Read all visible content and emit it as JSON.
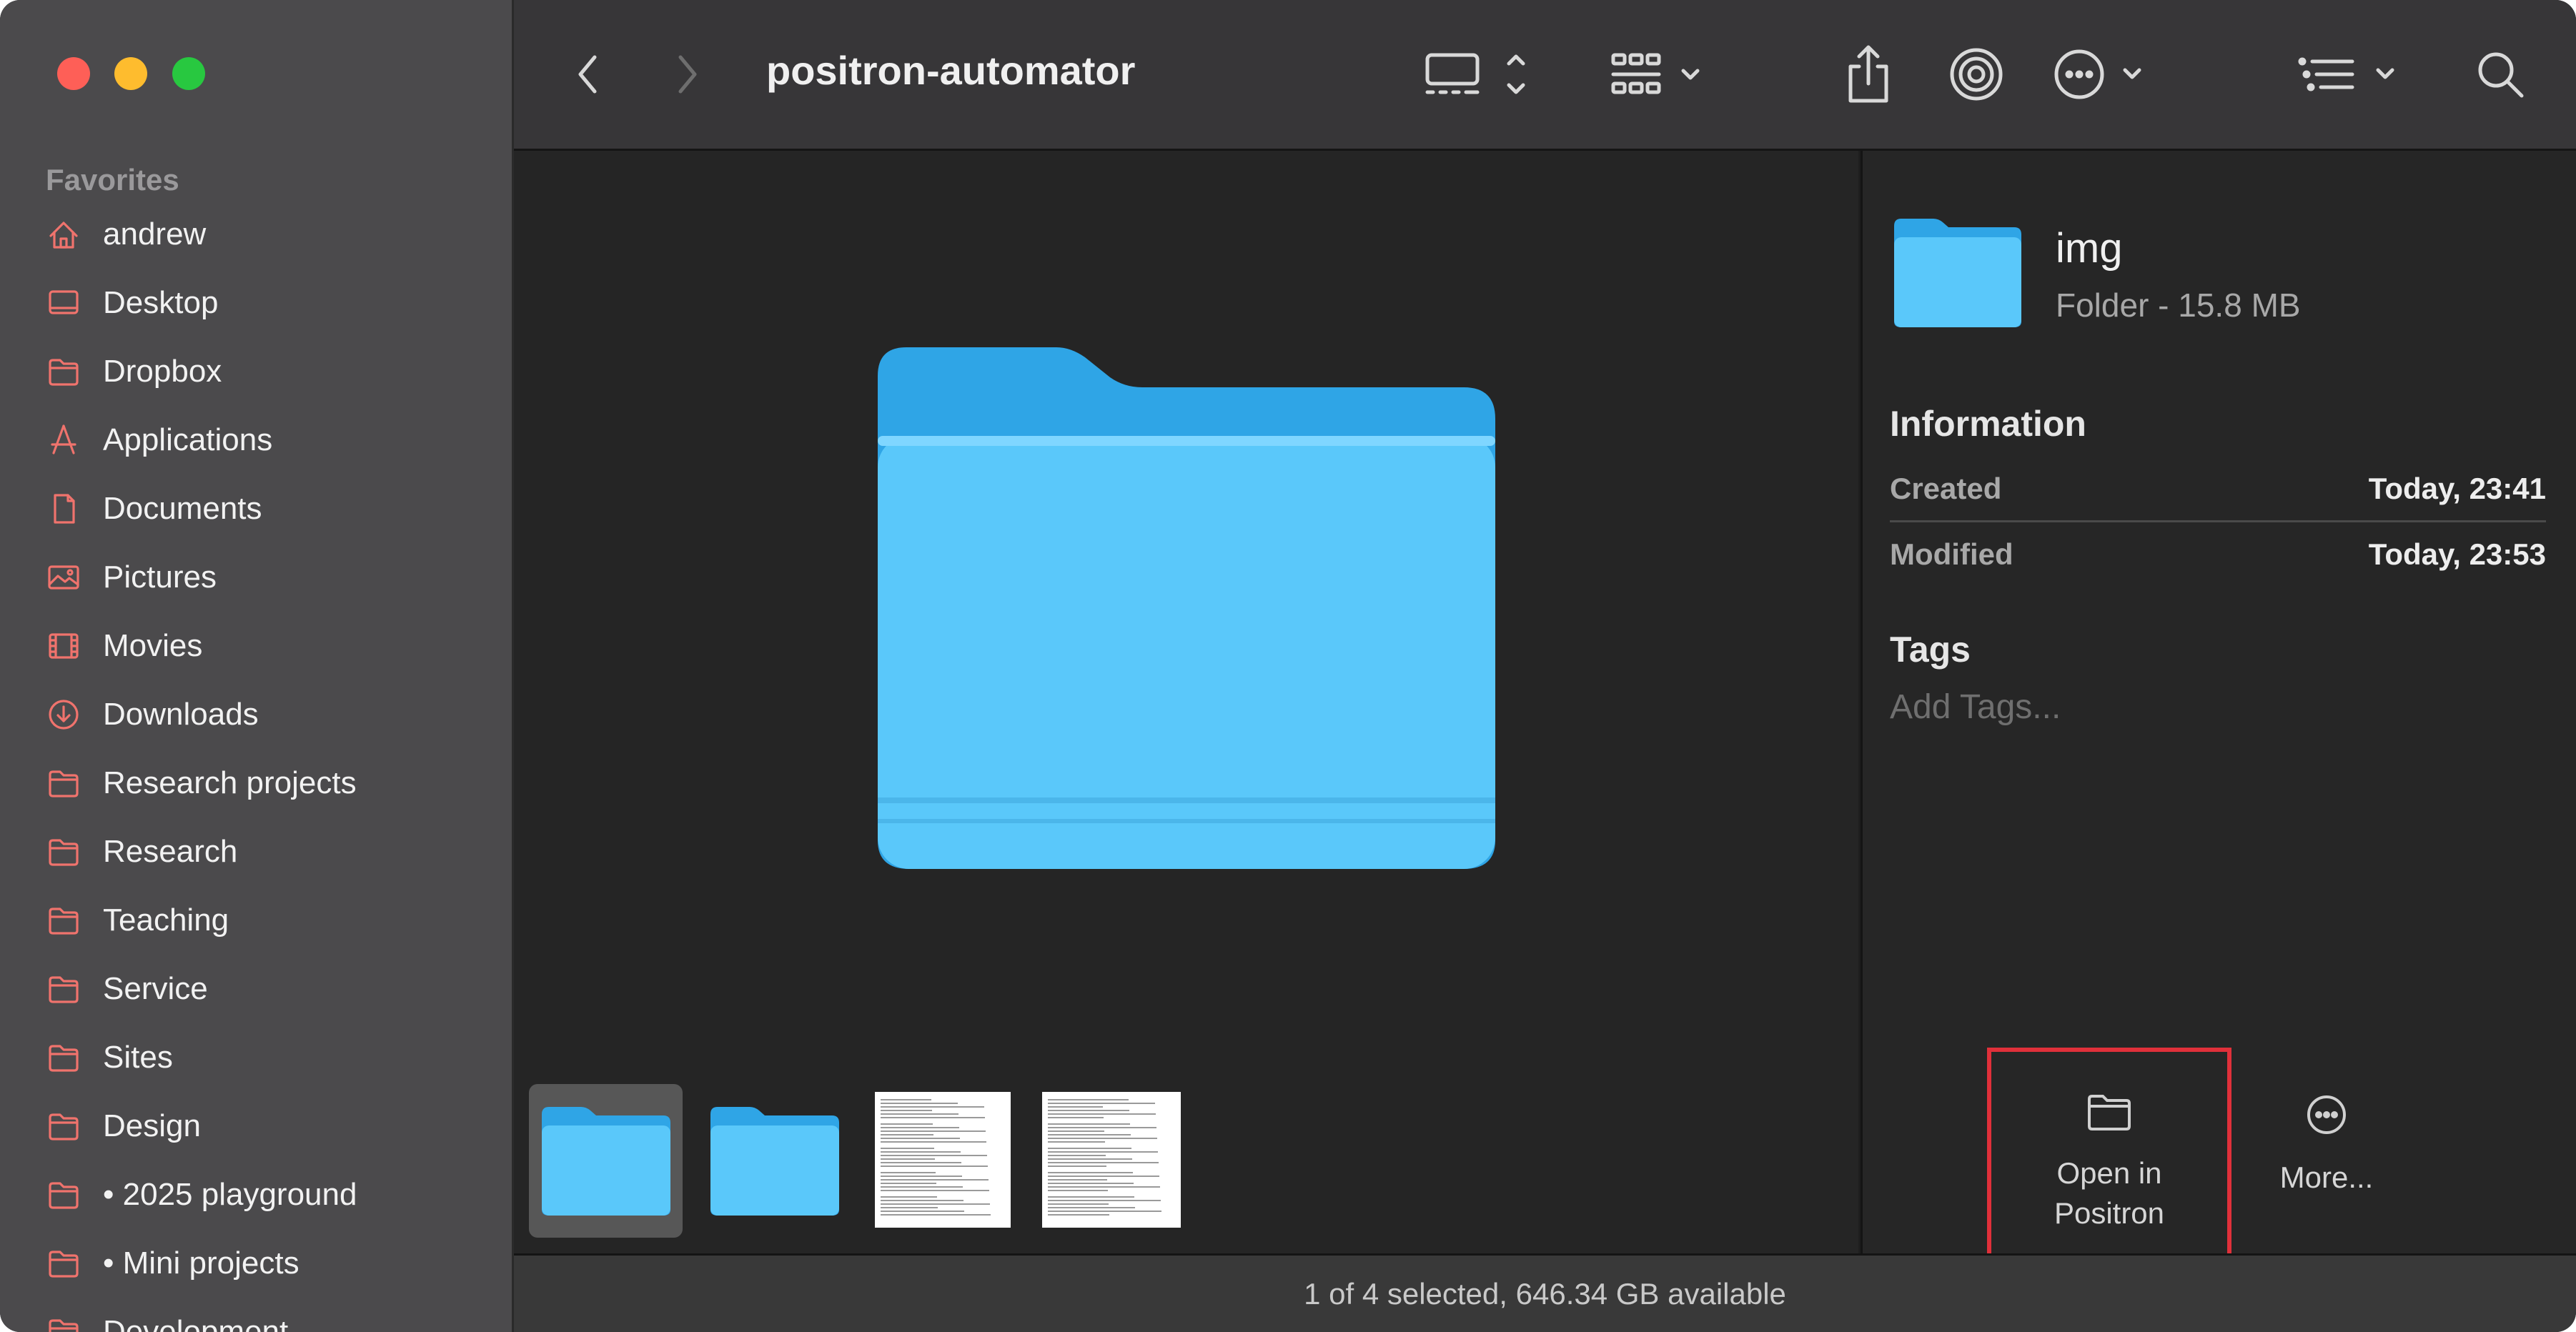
{
  "window": {
    "title": "positron-automator"
  },
  "sidebar": {
    "section": "Favorites",
    "items": [
      {
        "label": "andrew",
        "icon": "home-icon"
      },
      {
        "label": "Desktop",
        "icon": "desktop-icon"
      },
      {
        "label": "Dropbox",
        "icon": "folder-icon"
      },
      {
        "label": "Applications",
        "icon": "applications-icon"
      },
      {
        "label": "Documents",
        "icon": "document-icon"
      },
      {
        "label": "Pictures",
        "icon": "pictures-icon"
      },
      {
        "label": "Movies",
        "icon": "movies-icon"
      },
      {
        "label": "Downloads",
        "icon": "downloads-icon"
      },
      {
        "label": "Research projects",
        "icon": "folder-icon"
      },
      {
        "label": "Research",
        "icon": "folder-icon"
      },
      {
        "label": "Teaching",
        "icon": "folder-icon"
      },
      {
        "label": "Service",
        "icon": "folder-icon"
      },
      {
        "label": "Sites",
        "icon": "folder-icon"
      },
      {
        "label": "Design",
        "icon": "folder-icon"
      },
      {
        "label": "• 2025 playground",
        "icon": "folder-icon"
      },
      {
        "label": "• Mini projects",
        "icon": "folder-icon"
      },
      {
        "label": "Development",
        "icon": "folder-icon"
      }
    ],
    "icon_color": "#f0736d"
  },
  "toolbar": {
    "icons": [
      "back-icon",
      "forward-icon",
      "gallery-view-icon",
      "group-icon",
      "share-icon",
      "airdrop-icon",
      "action-menu-icon",
      "list-options-icon",
      "search-icon"
    ]
  },
  "gallery": {
    "selected_index": 0,
    "thumbnails": [
      "folder",
      "folder",
      "document",
      "document"
    ],
    "folder_color": "#5ac8fa"
  },
  "inspector": {
    "name": "img",
    "kind": "Folder - 15.8 MB",
    "info_heading": "Information",
    "created_label": "Created",
    "created_value": "Today, 23:41",
    "modified_label": "Modified",
    "modified_value": "Today, 23:53",
    "tags_heading": "Tags",
    "tags_placeholder": "Add Tags...",
    "actions": {
      "open_label": "Open in Positron",
      "more_label": "More..."
    },
    "highlight_color": "#e0303a"
  },
  "status": {
    "text": "1 of 4 selected, 646.34 GB available"
  }
}
